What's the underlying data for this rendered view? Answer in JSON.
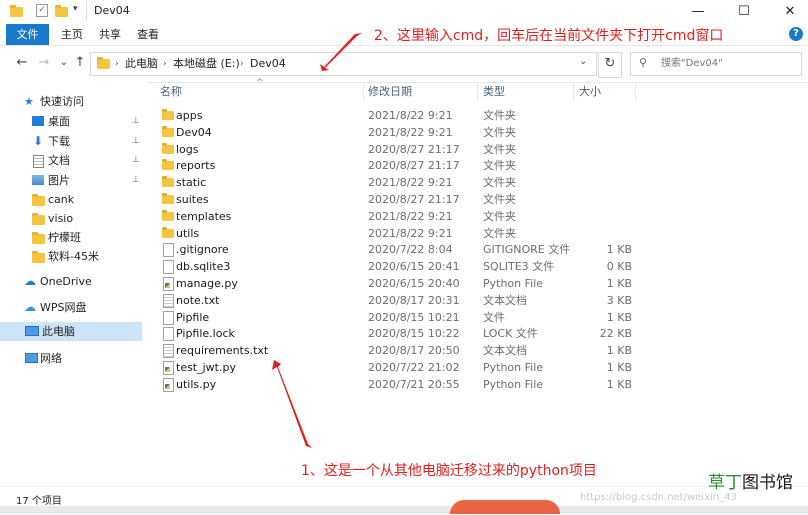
{
  "window": {
    "title": "Dev04",
    "minimize_glyph": "—",
    "maximize_glyph": "☐",
    "close_glyph": "✕"
  },
  "ribbon": {
    "tabs": [
      {
        "label": "文件",
        "active": true
      },
      {
        "label": "主页",
        "active": false
      },
      {
        "label": "共享",
        "active": false
      },
      {
        "label": "查看",
        "active": false
      }
    ],
    "help_glyph": "?"
  },
  "address": {
    "back_glyph": "←",
    "forward_glyph": "→",
    "recent_glyph": "⌄",
    "up_glyph": "↑",
    "crumbs": [
      "此电脑",
      "本地磁盘 (E:)",
      "Dev04"
    ],
    "separator": "›",
    "dropdown_glyph": "⌄",
    "refresh_glyph": "↻",
    "search_placeholder": "搜索\"Dev04\""
  },
  "columns": {
    "name": "名称",
    "date": "修改日期",
    "type": "类型",
    "size": "大小",
    "sort_glyph": "^"
  },
  "nav_pane": {
    "items": [
      {
        "label": "快速访问",
        "icon": "star-icon",
        "pinned": false
      },
      {
        "label": "桌面",
        "icon": "desktop-icon",
        "pinned": true
      },
      {
        "label": "下载",
        "icon": "download-icon",
        "pinned": true
      },
      {
        "label": "文档",
        "icon": "documents-icon",
        "pinned": true
      },
      {
        "label": "图片",
        "icon": "pictures-icon",
        "pinned": true
      },
      {
        "label": "cank",
        "icon": "folder-icon",
        "pinned": false
      },
      {
        "label": "visio",
        "icon": "folder-icon",
        "pinned": false
      },
      {
        "label": "柠檬班",
        "icon": "folder-icon",
        "pinned": false
      },
      {
        "label": "软料-45米",
        "icon": "folder-icon",
        "pinned": false
      },
      {
        "label": "OneDrive",
        "icon": "cloud-icon",
        "pinned": false
      },
      {
        "label": "WPS网盘",
        "icon": "cloud-icon",
        "pinned": false
      },
      {
        "label": "此电脑",
        "icon": "computer-icon",
        "pinned": false,
        "selected": true
      },
      {
        "label": "网络",
        "icon": "network-icon",
        "pinned": false
      }
    ],
    "pin_glyph": "📌"
  },
  "files": [
    {
      "name": "apps",
      "date": "2021/8/22 9:21",
      "type": "文件夹",
      "size": "",
      "icon": "folder"
    },
    {
      "name": "Dev04",
      "date": "2021/8/22 9:21",
      "type": "文件夹",
      "size": "",
      "icon": "folder"
    },
    {
      "name": "logs",
      "date": "2020/8/27 21:17",
      "type": "文件夹",
      "size": "",
      "icon": "folder"
    },
    {
      "name": "reports",
      "date": "2020/8/27 21:17",
      "type": "文件夹",
      "size": "",
      "icon": "folder"
    },
    {
      "name": "static",
      "date": "2021/8/22 9:21",
      "type": "文件夹",
      "size": "",
      "icon": "folder"
    },
    {
      "name": "suites",
      "date": "2020/8/27 21:17",
      "type": "文件夹",
      "size": "",
      "icon": "folder"
    },
    {
      "name": "templates",
      "date": "2021/8/22 9:21",
      "type": "文件夹",
      "size": "",
      "icon": "folder"
    },
    {
      "name": "utils",
      "date": "2021/8/22 9:21",
      "type": "文件夹",
      "size": "",
      "icon": "folder"
    },
    {
      "name": ".gitignore",
      "date": "2020/7/22 8:04",
      "type": "GITIGNORE 文件",
      "size": "1 KB",
      "icon": "file"
    },
    {
      "name": "db.sqlite3",
      "date": "2020/6/15 20:41",
      "type": "SQLITE3 文件",
      "size": "0 KB",
      "icon": "file"
    },
    {
      "name": "manage.py",
      "date": "2020/6/15 20:40",
      "type": "Python File",
      "size": "1 KB",
      "icon": "py"
    },
    {
      "name": "note.txt",
      "date": "2020/8/17 20:31",
      "type": "文本文档",
      "size": "3 KB",
      "icon": "txt"
    },
    {
      "name": "Pipfile",
      "date": "2020/8/15 10:21",
      "type": "文件",
      "size": "1 KB",
      "icon": "file"
    },
    {
      "name": "Pipfile.lock",
      "date": "2020/8/15 10:22",
      "type": "LOCK 文件",
      "size": "22 KB",
      "icon": "file"
    },
    {
      "name": "requirements.txt",
      "date": "2020/8/17 20:50",
      "type": "文本文档",
      "size": "1 KB",
      "icon": "txt"
    },
    {
      "name": "test_jwt.py",
      "date": "2020/7/22 21:02",
      "type": "Python File",
      "size": "1 KB",
      "icon": "py"
    },
    {
      "name": "utils.py",
      "date": "2020/7/21 20:55",
      "type": "Python File",
      "size": "1 KB",
      "icon": "py"
    }
  ],
  "status": {
    "count": "17 个项目"
  },
  "annotations": {
    "top": "2、这里输入cmd，回车后在当前文件夹下打开cmd窗口",
    "bottom": "1、这是一个从其他电脑迁移过来的python项目"
  },
  "watermark": "https://blog.csdn.net/weixin_43",
  "brand": {
    "part1": "草丁",
    "part2": "图书馆"
  },
  "colors": {
    "accent": "#1979ca",
    "annotation": "#e02020",
    "selection": "#cce4f7",
    "folder": "#f5c542"
  }
}
